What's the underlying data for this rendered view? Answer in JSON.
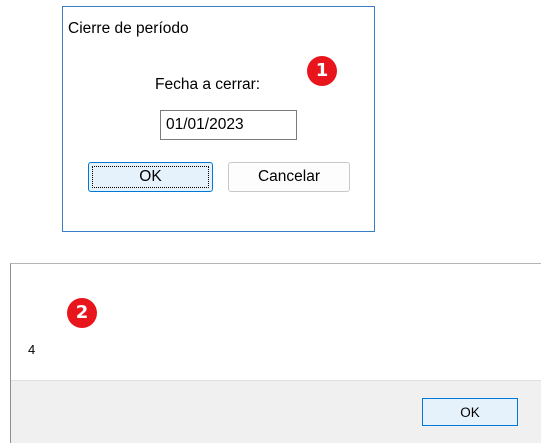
{
  "dialog1": {
    "title": "Cierre de período",
    "field_label": "Fecha a cerrar:",
    "date_value": "01/01/2023",
    "ok_label": "OK",
    "cancel_label": "Cancelar"
  },
  "dialog2": {
    "message": "4",
    "ok_label": "OK"
  },
  "badges": {
    "first": "1",
    "second": "2"
  },
  "colors": {
    "badge": "#e8161c",
    "dialog_border": "#3b7dc4",
    "focused_button_border": "#0078d7",
    "focused_button_fill": "#e5f1fb",
    "footer_bg": "#f0f0f0"
  }
}
